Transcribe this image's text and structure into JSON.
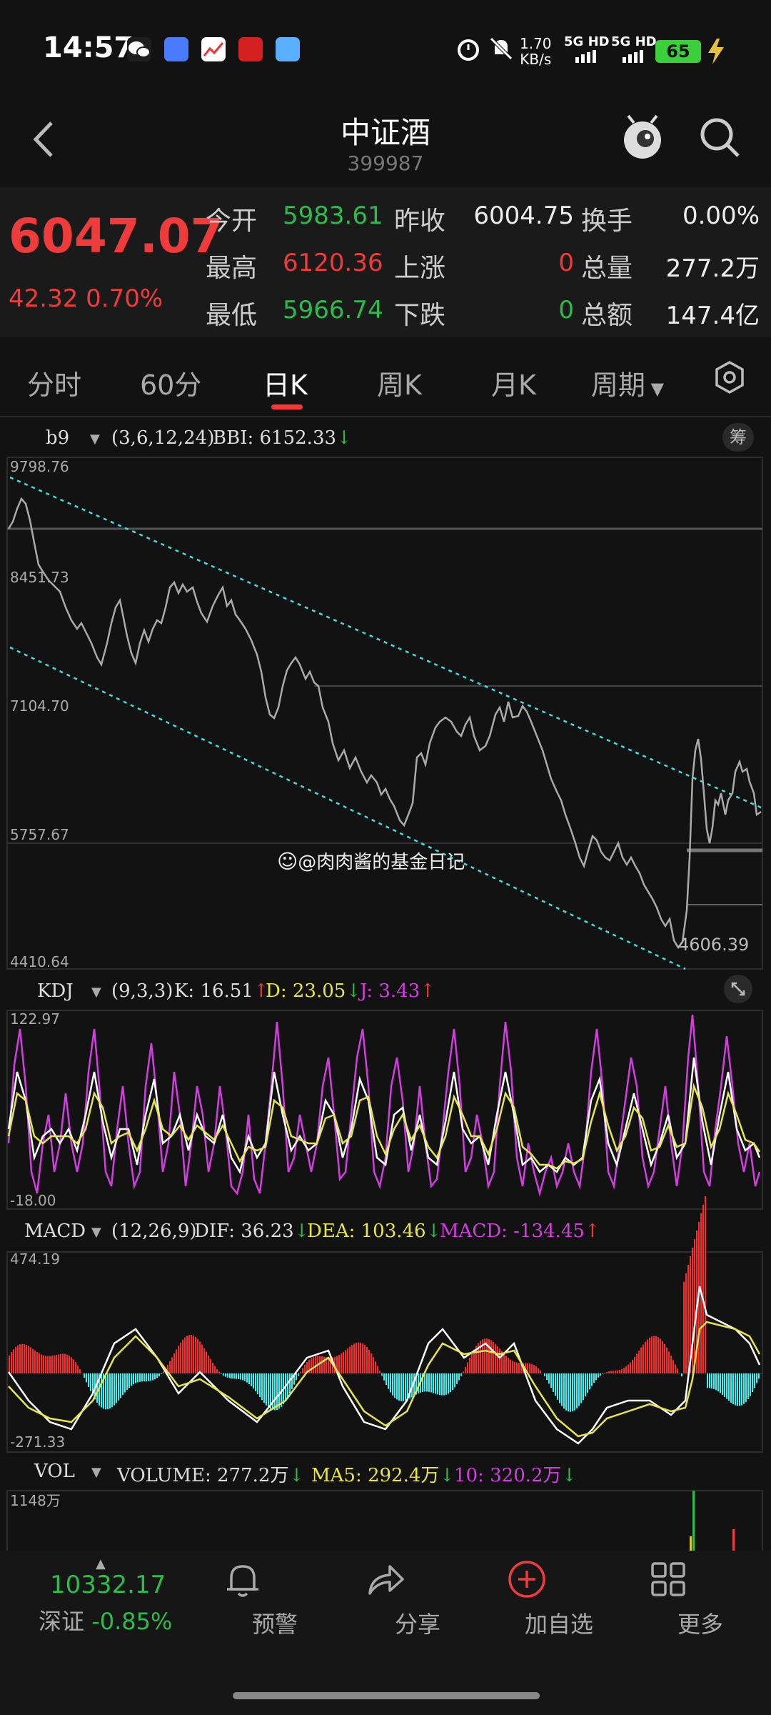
{
  "status": {
    "time": "14:57",
    "net_speed": "1.70\nKB/s",
    "signal1": "5G HD",
    "signal2": "5G HD",
    "battery": "65"
  },
  "header": {
    "title": "中证酒",
    "code": "399987"
  },
  "quote": {
    "price": "6047.07",
    "change": "42.32",
    "change_pct": "0.70%",
    "open_label": "今开",
    "open": "5983.61",
    "high_label": "最高",
    "high": "6120.36",
    "low_label": "最低",
    "low": "5966.74",
    "prev_close_label": "昨收",
    "prev_close": "6004.75",
    "up_label": "上涨",
    "up": "0",
    "down_label": "下跌",
    "down": "0",
    "turnover_label": "换手",
    "turnover": "0.00%",
    "volume_label": "总量",
    "volume": "277.2万",
    "amount_label": "总额",
    "amount": "147.4亿"
  },
  "tabs": [
    "分时",
    "60分",
    "日K",
    "周K",
    "月K",
    "周期"
  ],
  "active_tab": "日K",
  "main_chart": {
    "indicator": "b9",
    "params": "(3,6,12,24)",
    "bbi": "BBI: 6152.33",
    "chip_button": "筹",
    "y_ticks": [
      "9798.76",
      "8451.73",
      "7104.70",
      "5757.67",
      "4410.64"
    ],
    "low_marker": "4606.39",
    "watermark": "@肉肉酱的基金日记"
  },
  "kdj": {
    "name": "KDJ",
    "params": "(9,3,3)",
    "k": "K: 16.51",
    "d": "D: 23.05",
    "j": "J: 3.43",
    "y_max": "122.97",
    "y_min": "-18.00"
  },
  "macd": {
    "name": "MACD",
    "params": "(12,26,9)",
    "dif": "DIF: 36.23",
    "dea": "DEA: 103.46",
    "macd": "MACD: -134.45",
    "y_max": "474.19",
    "y_min": "-271.33"
  },
  "vol": {
    "name": "VOL",
    "volume": "VOLUME: 277.2万",
    "ma5": "MA5: 292.4万",
    "ma10": "10: 320.2万",
    "y_max": "1148万"
  },
  "bottom": {
    "index_value": "10332.17",
    "index_name": "深证",
    "index_change": "-0.85%",
    "alert": "预警",
    "share": "分享",
    "add": "加自选",
    "more": "更多"
  },
  "colors": {
    "up": "#ee3b3b",
    "down": "#2dbb4e",
    "kdj_k": "#ffffff",
    "kdj_d": "#e6e64a",
    "kdj_j": "#d23ee0",
    "macd_up": "#ff2a2a",
    "macd_down": "#3ff0f0",
    "channel": "#3fe0e0"
  }
}
